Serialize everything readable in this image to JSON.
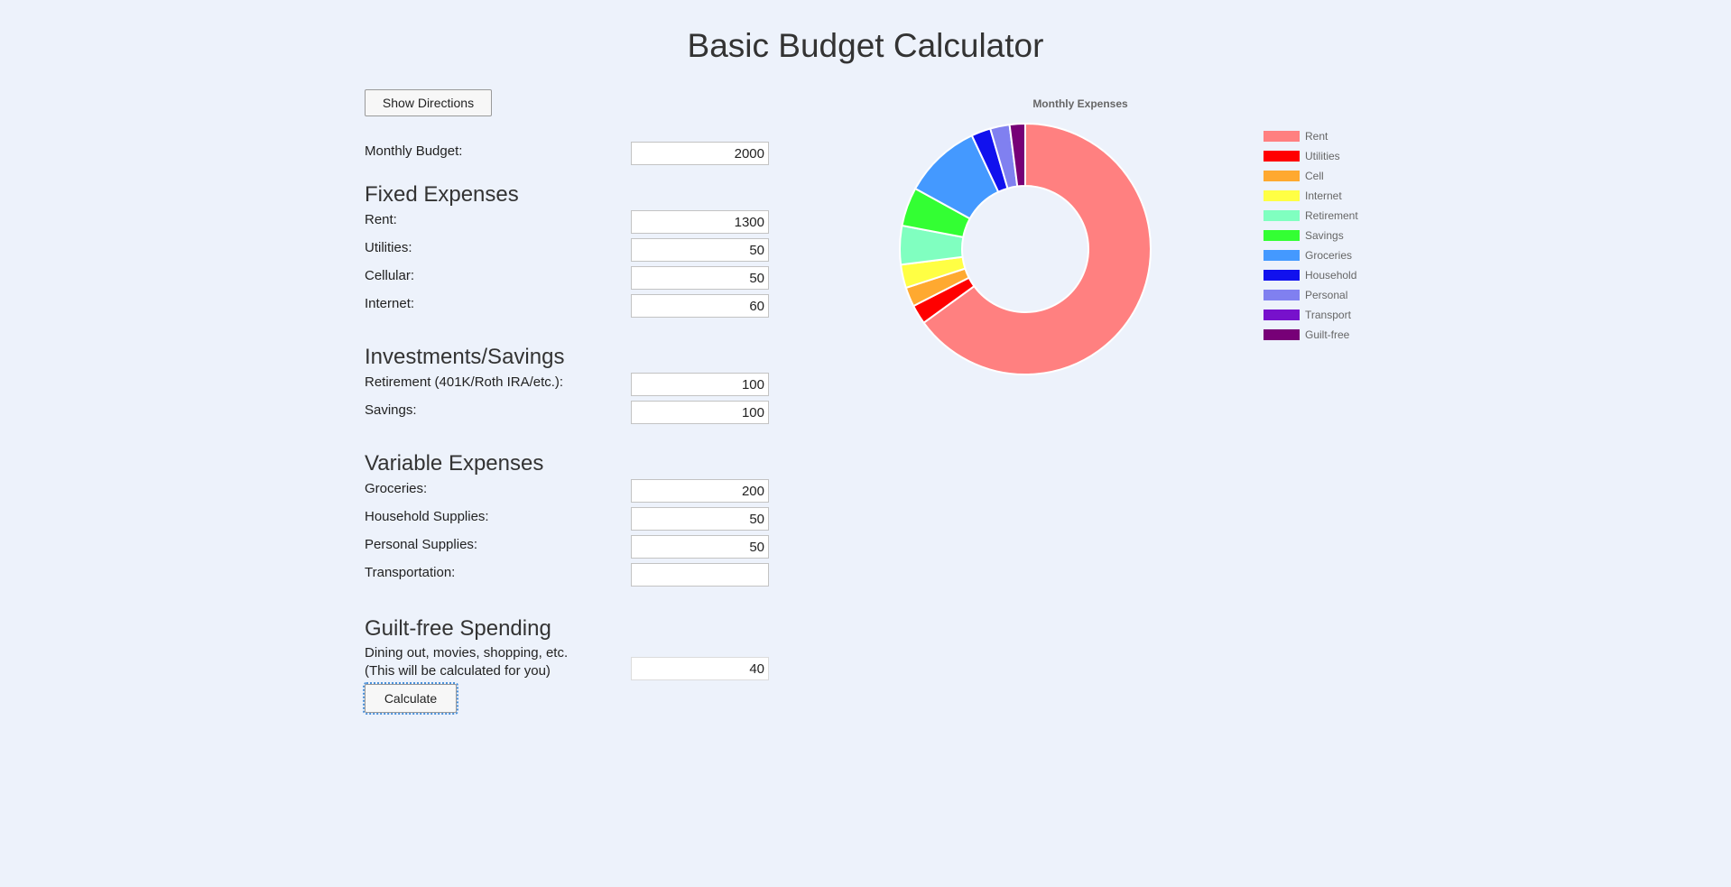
{
  "title": "Basic Budget Calculator",
  "directions_button": "Show Directions",
  "monthly_budget": {
    "label": "Monthly Budget:",
    "value": "2000"
  },
  "sections": {
    "fixed": {
      "title": "Fixed Expenses",
      "rows": [
        {
          "label": "Rent:",
          "value": "1300"
        },
        {
          "label": "Utilities:",
          "value": "50"
        },
        {
          "label": "Cellular:",
          "value": "50"
        },
        {
          "label": "Internet:",
          "value": "60"
        }
      ]
    },
    "investments": {
      "title": "Investments/Savings",
      "rows": [
        {
          "label": "Retirement (401K/Roth IRA/etc.):",
          "value": "100"
        },
        {
          "label": "Savings:",
          "value": "100"
        }
      ]
    },
    "variable": {
      "title": "Variable Expenses",
      "rows": [
        {
          "label": "Groceries:",
          "value": "200"
        },
        {
          "label": "Household Supplies:",
          "value": "50"
        },
        {
          "label": "Personal Supplies:",
          "value": "50"
        },
        {
          "label": "Transportation:",
          "value": ""
        }
      ]
    },
    "guilt": {
      "title": "Guilt-free Spending",
      "label_line1": "Dining out, movies, shopping, etc.",
      "label_line2": "(This will be calculated for you)",
      "value": "40"
    }
  },
  "calculate_button": "Calculate",
  "chart_data": {
    "type": "pie",
    "variant": "doughnut",
    "title": "Monthly Expenses",
    "legend_position": "right",
    "categories": [
      "Rent",
      "Utilities",
      "Cell",
      "Internet",
      "Retirement",
      "Savings",
      "Groceries",
      "Household",
      "Personal",
      "Transport",
      "Guilt-free"
    ],
    "values": [
      1300,
      50,
      50,
      60,
      100,
      100,
      200,
      50,
      50,
      0,
      40
    ],
    "colors": [
      "#ff8080",
      "#ff0000",
      "#ffa930",
      "#ffff44",
      "#80ffc0",
      "#33ff33",
      "#4499ff",
      "#1111ee",
      "#8080f0",
      "#7711cc",
      "#770077"
    ]
  }
}
